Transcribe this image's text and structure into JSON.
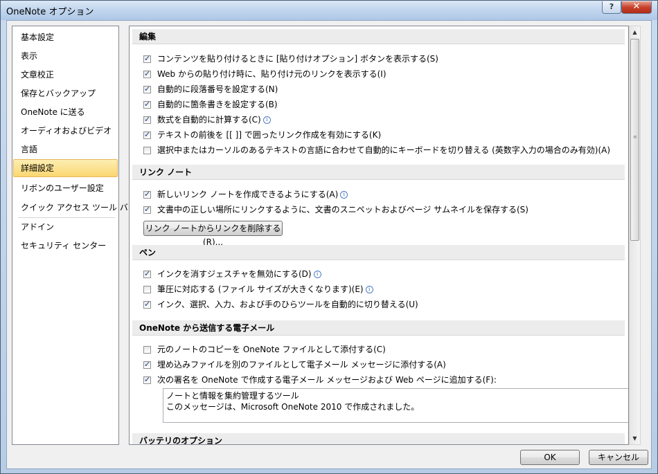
{
  "window": {
    "title": "OneNote オプション",
    "help_glyph": "?",
    "close_glyph": "✕"
  },
  "nav": {
    "items": [
      {
        "label": "基本設定"
      },
      {
        "label": "表示"
      },
      {
        "label": "文章校正"
      },
      {
        "label": "保存とバックアップ"
      },
      {
        "label": "OneNote に送る"
      },
      {
        "label": "オーディオおよびビデオ"
      },
      {
        "label": "言語"
      },
      {
        "label": "詳細設定",
        "selected": true
      },
      {
        "label": "リボンのユーザー設定"
      },
      {
        "label": "クイック アクセス ツール バー"
      },
      {
        "label": "アドイン"
      },
      {
        "label": "セキュリティ センター"
      }
    ]
  },
  "sections": {
    "edit": "編集",
    "linked_notes": "リンク ノート",
    "pen": "ペン",
    "email": "OneNote から送信する電子メール",
    "battery": "バッテリのオプション"
  },
  "options": {
    "edit": [
      {
        "label": "コンテンツを貼り付けるときに [貼り付けオプション] ボタンを表示する(S)",
        "checked": true
      },
      {
        "label": "Web からの貼り付け時に、貼り付け元のリンクを表示する(I)",
        "checked": true
      },
      {
        "label": "自動的に段落番号を設定する(N)",
        "checked": true
      },
      {
        "label": "自動的に箇条書きを設定する(B)",
        "checked": true
      },
      {
        "label": "数式を自動的に計算する(C)",
        "checked": true,
        "info": "i"
      },
      {
        "label": "テキストの前後を [[ ]] で囲ったリンク作成を有効にする(K)",
        "checked": true
      },
      {
        "label": "選択中またはカーソルのあるテキストの言語に合わせて自動的にキーボードを切り替える (英数字入力の場合のみ有効)(A)",
        "checked": false
      }
    ],
    "linked_notes": [
      {
        "label": "新しいリンク ノートを作成できるようにする(A)",
        "checked": true,
        "info": "i"
      },
      {
        "label": "文書中の正しい場所にリンクするように、文書のスニペットおよびページ サムネイルを保存する(S)",
        "checked": true
      }
    ],
    "pen": [
      {
        "label": "インクを消すジェスチャを無効にする(D)",
        "checked": true,
        "info": "i"
      },
      {
        "label": "筆圧に対応する (ファイル サイズが大きくなります)(E)",
        "checked": false,
        "info": "i"
      },
      {
        "label": "インク、選択、入力、および手のひらツールを自動的に切り替える(U)",
        "checked": true
      }
    ],
    "email": [
      {
        "label": "元のノートのコピーを OneNote ファイルとして添付する(C)",
        "checked": false
      },
      {
        "label": "埋め込みファイルを別のファイルとして電子メール メッセージに添付する(A)",
        "checked": true
      },
      {
        "label": "次の署名を OneNote で作成する電子メール メッセージおよび Web ページに追加する(F):",
        "checked": true
      }
    ]
  },
  "remove_links_button": "リンク ノートからリンクを削除する(R)...",
  "signature": {
    "line1": "ノートと情報を集約管理するツール",
    "line2": "このメッセージは、Microsoft OneNote 2010 で作成されました。"
  },
  "footer": {
    "ok": "OK",
    "cancel": "キャンセル"
  },
  "scrollbar": {
    "up_glyph": "▲",
    "down_glyph": "▼",
    "grip_glyph": "≡"
  }
}
